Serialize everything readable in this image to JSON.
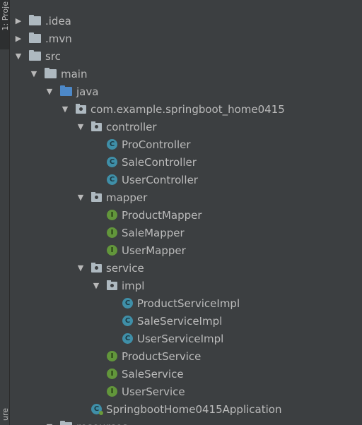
{
  "stripe": {
    "project_tab": "1: Proje",
    "structure_tab": "ure"
  },
  "tree": [
    {
      "label": ".idea",
      "icon": "folder",
      "indent": 1,
      "arrow": "collapsed"
    },
    {
      "label": ".mvn",
      "icon": "folder",
      "indent": 1,
      "arrow": "collapsed"
    },
    {
      "label": "src",
      "icon": "folder",
      "indent": 1,
      "arrow": "expanded"
    },
    {
      "label": "main",
      "icon": "folder",
      "indent": 2,
      "arrow": "expanded"
    },
    {
      "label": "java",
      "icon": "source-folder",
      "indent": 3,
      "arrow": "expanded"
    },
    {
      "label": "com.example.springboot_home0415",
      "icon": "package",
      "indent": 4,
      "arrow": "expanded"
    },
    {
      "label": "controller",
      "icon": "package",
      "indent": 5,
      "arrow": "expanded"
    },
    {
      "label": "ProController",
      "icon": "class",
      "indent": 6,
      "arrow": ""
    },
    {
      "label": "SaleController",
      "icon": "class",
      "indent": 6,
      "arrow": ""
    },
    {
      "label": "UserController",
      "icon": "class",
      "indent": 6,
      "arrow": ""
    },
    {
      "label": "mapper",
      "icon": "package",
      "indent": 5,
      "arrow": "expanded"
    },
    {
      "label": "ProductMapper",
      "icon": "interface",
      "indent": 6,
      "arrow": ""
    },
    {
      "label": "SaleMapper",
      "icon": "interface",
      "indent": 6,
      "arrow": ""
    },
    {
      "label": "UserMapper",
      "icon": "interface",
      "indent": 6,
      "arrow": ""
    },
    {
      "label": "service",
      "icon": "package",
      "indent": 5,
      "arrow": "expanded"
    },
    {
      "label": "impl",
      "icon": "package",
      "indent": 6,
      "arrow": "expanded"
    },
    {
      "label": "ProductServiceImpl",
      "icon": "class",
      "indent": 7,
      "arrow": ""
    },
    {
      "label": "SaleServiceImpl",
      "icon": "class",
      "indent": 7,
      "arrow": ""
    },
    {
      "label": "UserServiceImpl",
      "icon": "class",
      "indent": 7,
      "arrow": ""
    },
    {
      "label": "ProductService",
      "icon": "interface",
      "indent": 6,
      "arrow": ""
    },
    {
      "label": "SaleService",
      "icon": "interface",
      "indent": 6,
      "arrow": ""
    },
    {
      "label": "UserService",
      "icon": "interface",
      "indent": 6,
      "arrow": ""
    },
    {
      "label": "SpringbootHome0415Application",
      "icon": "spring-app-class",
      "indent": 5,
      "arrow": ""
    },
    {
      "label": "resources",
      "icon": "folder",
      "indent": 3,
      "arrow": "expanded"
    }
  ],
  "colors": {
    "background": "#3c3f41",
    "text": "#bbbbbb",
    "class_icon": "#3f8fa8",
    "interface_icon": "#62963b",
    "source_folder": "#4d89c9"
  }
}
